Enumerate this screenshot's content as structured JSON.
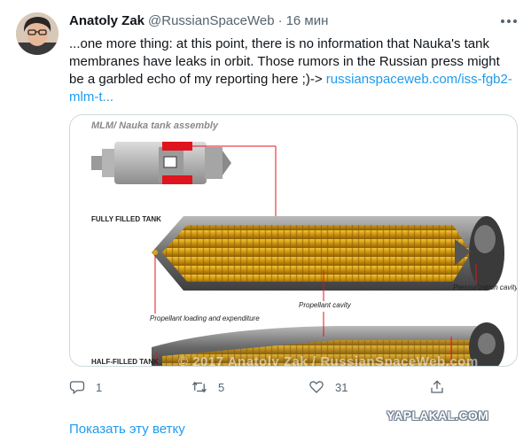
{
  "tweet": {
    "author_name": "Anatoly Zak",
    "author_handle": "@RussianSpaceWeb",
    "separator": "·",
    "time": "16 мин",
    "text": "...one more thing: at this point, there is no information that Nauka's tank membranes have leaks in orbit. Those rumors in the Russian press might be a garbled echo of my reporting here ;)->",
    "link_text": "russianspaceweb.com/iss-fgb2-mlm-t...",
    "more_icon": "more-icon"
  },
  "image": {
    "title": "MLM/ Nauka tank assembly",
    "label_full": "FULLY FILLED TANK",
    "label_half": "HALF-FILLED TANK",
    "label_pressurization": "Pressurization cavity",
    "label_propellant_cavity": "Propellant cavity",
    "label_loading": "Propellant loading and expenditure",
    "watermark": "© 2017 Anatoly Zak / RussianSpaceWeb.com",
    "colors": {
      "tank_gray": "#7d7d7d",
      "bladder_gold": "#d9a21a",
      "callout_red": "#e0141e"
    }
  },
  "actions": {
    "reply_count": "1",
    "retweet_count": "5",
    "like_count": "31",
    "icons": [
      "reply-icon",
      "retweet-icon",
      "like-icon",
      "share-icon"
    ]
  },
  "show_thread": "Показать эту ветку",
  "watermark_site": "YAPLAKAL.COM",
  "colors": {
    "link": "#1d9bf0",
    "secondary": "#536471",
    "border": "#cfd9de"
  }
}
